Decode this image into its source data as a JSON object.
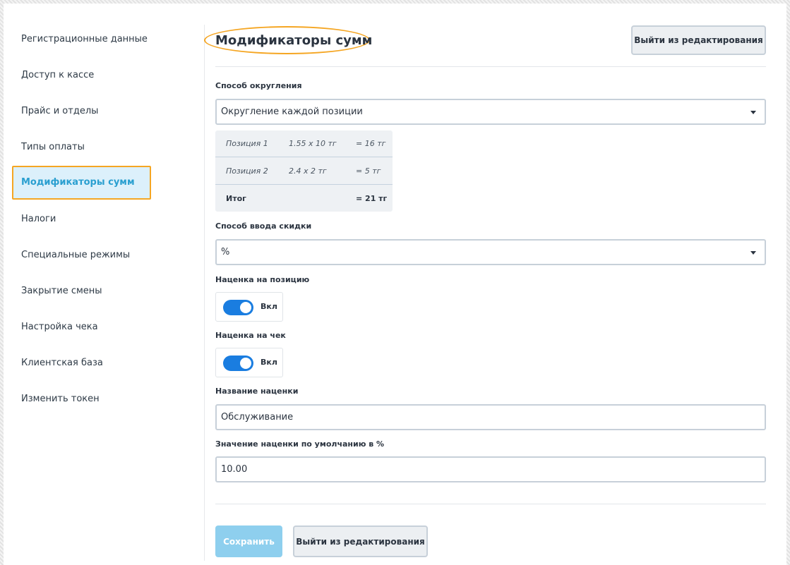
{
  "sidebar": {
    "items": [
      {
        "label": "Регистрационные данные"
      },
      {
        "label": "Доступ к кассе"
      },
      {
        "label": "Прайс и отделы"
      },
      {
        "label": "Типы оплаты"
      },
      {
        "label": "Модификаторы сумм",
        "active": true
      },
      {
        "label": "Налоги"
      },
      {
        "label": "Специальные режимы"
      },
      {
        "label": "Закрытие смены"
      },
      {
        "label": "Настройка чека"
      },
      {
        "label": "Клиентская база"
      },
      {
        "label": "Изменить токен"
      }
    ]
  },
  "header": {
    "title": "Модификаторы сумм",
    "exit_label": "Выйти из редактирования"
  },
  "rounding": {
    "label": "Способ округления",
    "value": "Округление каждой позиции",
    "example": {
      "rows": [
        {
          "name": "Позиция 1",
          "calc": "1.55 x 10 тг",
          "result": "= 16 тг"
        },
        {
          "name": "Позиция 2",
          "calc": "2.4 x 2 тг",
          "result": "= 5 тг"
        }
      ],
      "total": {
        "name": "Итог",
        "result": "= 21 тг"
      }
    }
  },
  "discount": {
    "label": "Способ ввода скидки",
    "value": "%"
  },
  "markup_position": {
    "label": "Наценка на позицию",
    "toggle_text": "Вкл"
  },
  "markup_check": {
    "label": "Наценка на чек",
    "toggle_text": "Вкл"
  },
  "markup_name": {
    "label": "Название наценки",
    "value": "Обслуживание"
  },
  "markup_default": {
    "label": "Значение наценки по умолчанию в %",
    "value": "10.00"
  },
  "footer": {
    "save_label": "Сохранить",
    "exit_label": "Выйти из редактирования"
  },
  "colors": {
    "accent": "#2a9fd0",
    "highlight": "#f5a623",
    "toggle_on": "#1a7de0",
    "save_disabled": "#8ecfee"
  }
}
